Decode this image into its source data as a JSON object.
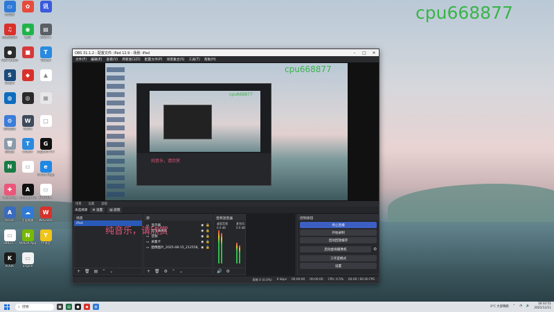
{
  "watermark": "cpu668877",
  "donate_text": "纯音乐，请欣赏",
  "desktop_icons": [
    {
      "label": "此电脑",
      "color": "#2f7ad6",
      "glyph": "▭"
    },
    {
      "label": "",
      "color": "#e64b3c",
      "glyph": "✿"
    },
    {
      "label": "",
      "color": "#3b5bdb",
      "glyph": "讯"
    },
    {
      "label": "网易云音乐",
      "color": "#d8312b",
      "glyph": "♫"
    },
    {
      "label": "微信",
      "color": "#21b34b",
      "glyph": "◉"
    },
    {
      "label": "2025-1-",
      "color": "#5a5f66",
      "glyph": "▤"
    },
    {
      "label": "OBS Studio",
      "color": "#2d2d2d",
      "glyph": "●"
    },
    {
      "label": "",
      "color": "#d43a3a",
      "glyph": "■"
    },
    {
      "label": "ToDesk",
      "color": "#2a8ae0",
      "glyph": "T"
    },
    {
      "label": "Steam",
      "color": "#1b4b7a",
      "glyph": "S"
    },
    {
      "label": "",
      "color": "#d8312b",
      "glyph": "◆"
    },
    {
      "label": "",
      "color": "#ffffff",
      "glyph": "▲"
    },
    {
      "label": "",
      "color": "#0f6cbd",
      "glyph": "◍"
    },
    {
      "label": "",
      "color": "#2a2a2a",
      "glyph": "◎"
    },
    {
      "label": "",
      "color": "#e7e7e7",
      "glyph": "▦"
    },
    {
      "label": "控制面板",
      "color": "#3b7dd8",
      "glyph": "⚙"
    },
    {
      "label": "WeGa",
      "color": "#3e4b5b",
      "glyph": "W"
    },
    {
      "label": "",
      "color": "#ffffff",
      "glyph": "□"
    },
    {
      "label": "回收站",
      "color": "#8a9aa8",
      "glyph": "🗑"
    },
    {
      "label": "todesk",
      "color": "#2a8ae0",
      "glyph": "T"
    },
    {
      "label": "Logitech G HUB",
      "color": "#111111",
      "glyph": "G"
    },
    {
      "label": "",
      "color": "#1a7b45",
      "glyph": "N"
    },
    {
      "label": "",
      "color": "#ffffff",
      "glyph": "▭"
    },
    {
      "label": "Micros Edge",
      "color": "#1e88e5",
      "glyph": "e"
    },
    {
      "label": "iMaoning",
      "color": "#e9577a",
      "glyph": "✚"
    },
    {
      "label": "Armoury Crate",
      "color": "#101010",
      "glyph": "A"
    },
    {
      "label": "371753...",
      "color": "#ffffff",
      "glyph": "▭"
    },
    {
      "label": "Assist.",
      "color": "#3b6bbd",
      "glyph": "A"
    },
    {
      "label": "百度网盘",
      "color": "#2f7ad6",
      "glyph": "☁"
    },
    {
      "label": "WeGame",
      "color": "#d8312b",
      "glyph": "W"
    },
    {
      "label": "a9d21...",
      "color": "#ffffff",
      "glyph": "▭"
    },
    {
      "label": "NVIDIA App",
      "color": "#76b900",
      "glyph": "N"
    },
    {
      "label": "YY语音",
      "color": "#f0c419",
      "glyph": "Y"
    },
    {
      "label": "KOOK",
      "color": "#1b1b1b",
      "glyph": "K"
    },
    {
      "label": "Engine",
      "color": "#f2f2f2",
      "glyph": "▭"
    }
  ],
  "obs": {
    "title": "OBS 31.1.2 - 配置文件: iPad 12.9 - 场景: iPad",
    "menu": [
      "文件(F)",
      "编辑(E)",
      "查看(V)",
      "停靠窗口(D)",
      "配置文件(P)",
      "场景集合(S)",
      "工具(T)",
      "帮助(H)"
    ],
    "preview_tabs": [
      "场景",
      "设置",
      "滤镜"
    ],
    "tabs_row": [
      "未选择源",
      "设置",
      "滤镜"
    ],
    "scenes": {
      "title": "场景",
      "items": [
        "iPad"
      ]
    },
    "sources": {
      "title": "源",
      "items": [
        "显示器",
        "显示器采集",
        "音频",
        "采集卡",
        "图像图片_2025-08-15_212558_175.png"
      ]
    },
    "mixer": {
      "title": "音频混音器",
      "channels": [
        {
          "name": "桌面音频",
          "level": "0.0 dB"
        },
        {
          "name": "麦克风",
          "level": "0.0 dB"
        }
      ]
    },
    "controls": {
      "title": "控制按钮",
      "buttons": [
        "停止直播",
        "开始录制",
        "启动回放缓存",
        "启动虚拟摄像机",
        "工作室模式",
        "设置"
      ]
    },
    "status": [
      "丢帧 0 (0.0%)",
      "0 kbps",
      "00:00:00",
      "00:00:00",
      "CPU: 0.5%",
      "60.00 / 60.00 FPS"
    ]
  },
  "taskbar": {
    "search_placeholder": "搜索",
    "tray_weather": "0°C 大部晴朗",
    "time": "18:32:51",
    "date": "2025/12/11"
  },
  "colors": {
    "watermark": "#3bb34a",
    "donate": "#e05577",
    "accent": "#3d5fc4"
  }
}
